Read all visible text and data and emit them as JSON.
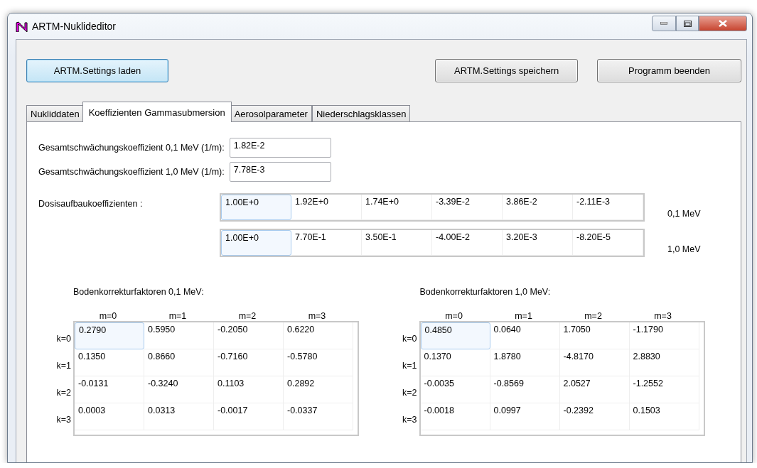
{
  "window": {
    "title": "ARTM-Nuklideditor"
  },
  "buttons": [
    {
      "label": "ARTM.Settings laden",
      "highlighted": true
    },
    {
      "label": "ARTM.Settings speichern",
      "highlighted": false
    },
    {
      "label": "Programm beenden",
      "highlighted": false
    }
  ],
  "tabs": [
    {
      "label": "Nukliddaten",
      "selected": false
    },
    {
      "label": "Koeffizienten Gammasubmersion",
      "selected": true
    },
    {
      "label": "Aerosolparameter",
      "selected": false
    },
    {
      "label": "Niederschlagsklassen",
      "selected": false
    }
  ],
  "fields": [
    {
      "label": "Gesamtschwächungskoeffizient 0,1 MeV (1/m):",
      "value": "1.82E-2"
    },
    {
      "label": "Gesamtschwächungskoeffizient 1,0 MeV (1/m):",
      "value": "7.78E-3"
    }
  ],
  "dose_buildup": {
    "label": "Dosisaufbaukoeffizienten :",
    "rows": [
      {
        "energy": "0,1 MeV",
        "cells": [
          {
            "value": "1.00E+0",
            "selected": true
          },
          {
            "value": "1.92E+0",
            "selected": false
          },
          {
            "value": "1.74E+0",
            "selected": false
          },
          {
            "value": "-3.39E-2",
            "selected": false
          },
          {
            "value": "3.86E-2",
            "selected": false
          },
          {
            "value": "-2.11E-3",
            "selected": false
          }
        ]
      },
      {
        "energy": "1,0 MeV",
        "cells": [
          {
            "value": "1.00E+0",
            "selected": true
          },
          {
            "value": "7.70E-1",
            "selected": false
          },
          {
            "value": "3.50E-1",
            "selected": false
          },
          {
            "value": "-4.00E-2",
            "selected": false
          },
          {
            "value": "3.20E-3",
            "selected": false
          },
          {
            "value": "-8.20E-5",
            "selected": false
          }
        ]
      }
    ]
  },
  "ground_correction": [
    {
      "title": "Bodenkorrekturfaktoren 0,1 MeV:",
      "columns": [
        "m=0",
        "m=1",
        "m=2",
        "m=3"
      ],
      "rows": [
        {
          "label": "k=0",
          "cells": [
            {
              "value": "0.2790",
              "selected": true
            },
            {
              "value": "0.5950",
              "selected": false
            },
            {
              "value": "-0.2050",
              "selected": false
            },
            {
              "value": "0.6220",
              "selected": false
            }
          ]
        },
        {
          "label": "k=1",
          "cells": [
            {
              "value": "0.1350",
              "selected": false
            },
            {
              "value": "0.8660",
              "selected": false
            },
            {
              "value": "-0.7160",
              "selected": false
            },
            {
              "value": "-0.5780",
              "selected": false
            }
          ]
        },
        {
          "label": "k=2",
          "cells": [
            {
              "value": "-0.0131",
              "selected": false
            },
            {
              "value": "-0.3240",
              "selected": false
            },
            {
              "value": "0.1103",
              "selected": false
            },
            {
              "value": "0.2892",
              "selected": false
            }
          ]
        },
        {
          "label": "k=3",
          "cells": [
            {
              "value": "0.0003",
              "selected": false
            },
            {
              "value": "0.0313",
              "selected": false
            },
            {
              "value": "-0.0017",
              "selected": false
            },
            {
              "value": "-0.0337",
              "selected": false
            }
          ]
        }
      ]
    },
    {
      "title": "Bodenkorrekturfaktoren 1,0 MeV:",
      "columns": [
        "m=0",
        "m=1",
        "m=2",
        "m=3"
      ],
      "rows": [
        {
          "label": "k=0",
          "cells": [
            {
              "value": "0.4850",
              "selected": true
            },
            {
              "value": "0.0640",
              "selected": false
            },
            {
              "value": "1.7050",
              "selected": false
            },
            {
              "value": "-1.1790",
              "selected": false
            }
          ]
        },
        {
          "label": "k=1",
          "cells": [
            {
              "value": "0.1370",
              "selected": false
            },
            {
              "value": "1.8780",
              "selected": false
            },
            {
              "value": "-4.8170",
              "selected": false
            },
            {
              "value": "2.8830",
              "selected": false
            }
          ]
        },
        {
          "label": "k=2",
          "cells": [
            {
              "value": "-0.0035",
              "selected": false
            },
            {
              "value": "-0.8569",
              "selected": false
            },
            {
              "value": "2.0527",
              "selected": false
            },
            {
              "value": "-1.2552",
              "selected": false
            }
          ]
        },
        {
          "label": "k=3",
          "cells": [
            {
              "value": "-0.0018",
              "selected": false
            },
            {
              "value": "0.0997",
              "selected": false
            },
            {
              "value": "-0.2392",
              "selected": false
            },
            {
              "value": "0.1503",
              "selected": false
            }
          ]
        }
      ]
    }
  ]
}
